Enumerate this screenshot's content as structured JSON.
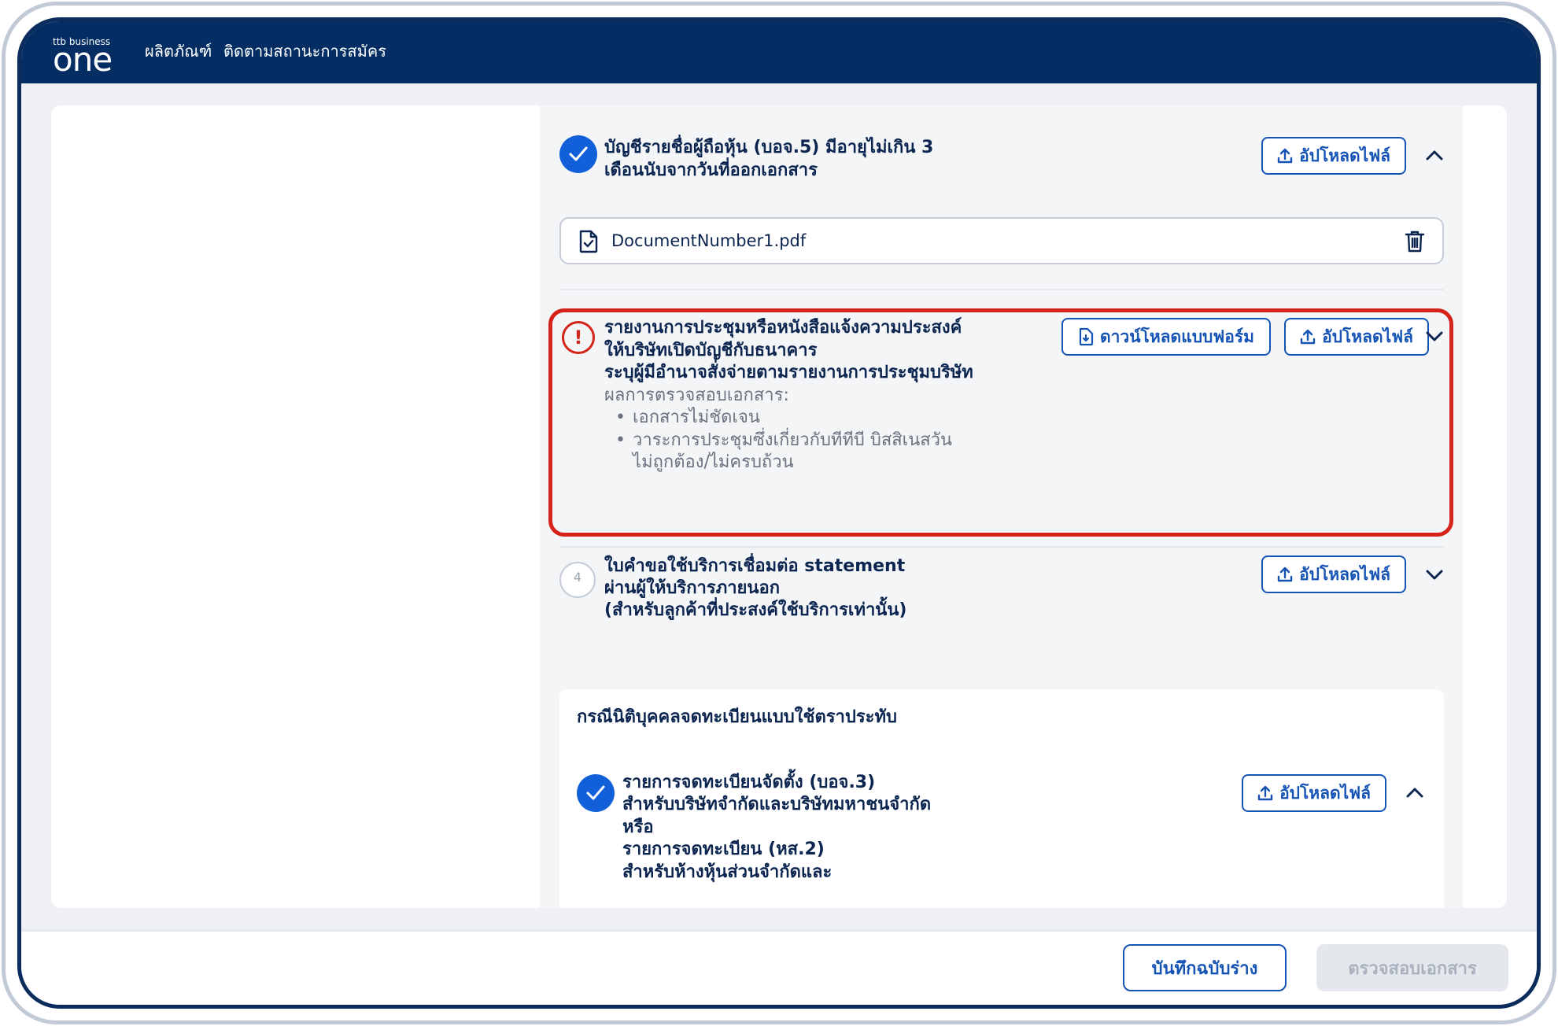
{
  "header": {
    "logo_small": "ttb business",
    "logo_main": "one",
    "nav": [
      "ผลิตภัณฑ์",
      "ติดตามสถานะการสมัคร"
    ]
  },
  "doc1": {
    "title_lines": [
      "บัญชีรายชื่อผู้ถือหุ้น (บอจ.5) มีอายุไม่เกิน 3",
      "เดือนนับจากวันที่ออกเอกสาร"
    ],
    "upload_label": "อัปโหลดไฟล์",
    "file_name": "DocumentNumber1.pdf",
    "status": "complete",
    "expanded": true
  },
  "doc2": {
    "title_lines": [
      "รายงานการประชุมหรือหนังสือแจ้งความประสงค์",
      "ให้บริษัทเปิดบัญชีกับธนาคาร",
      "ระบุผู้มีอำนาจสั่งจ่ายตามรายงานการประชุมบริษัท"
    ],
    "download_label": "ดาวน์โหลดแบบฟอร์ม",
    "upload_label": "อัปโหลดไฟล์",
    "result_label": "ผลการตรวจสอบเอกสาร:",
    "issues": [
      "เอกสารไม่ชัดเจน",
      "วาระการประชุมซึ่งเกี่ยวกับทีทีบี บิสสิเนสวัน",
      "ไม่ถูกต้อง/ไม่ครบถ้วน"
    ],
    "status": "error"
  },
  "doc3": {
    "step": "4",
    "title_lines": [
      "ใบคำขอใช้บริการเชื่อมต่อ statement",
      "ผ่านผู้ให้บริการภายนอก",
      "(สำหรับลูกค้าที่ประสงค์ใช้บริการเท่านั้น)"
    ],
    "upload_label": "อัปโหลดไฟล์"
  },
  "sub_section": {
    "heading": "กรณีนิติบุคคลจดทะเบียนแบบใช้ตราประทับ",
    "item_title_lines": [
      "รายการจดทะเบียนจัดตั้ง (บอจ.3)",
      "สำหรับบริษัทจำกัดและบริษัทมหาชนจำกัด",
      "หรือ",
      "รายการจดทะเบียน (หส.2)",
      "สำหรับห้างหุ้นส่วนจำกัดและ"
    ],
    "upload_label": "อัปโหลดไฟล์"
  },
  "footer": {
    "draft_label": "บันทึกฉบับร่าง",
    "verify_label": "ตรวจสอบเอกสาร"
  },
  "colors": {
    "header_bg": "#032d63",
    "primary": "#1553b5",
    "check": "#1160d9",
    "error": "#d5221a",
    "disabled_bg": "#e4e7ec"
  }
}
